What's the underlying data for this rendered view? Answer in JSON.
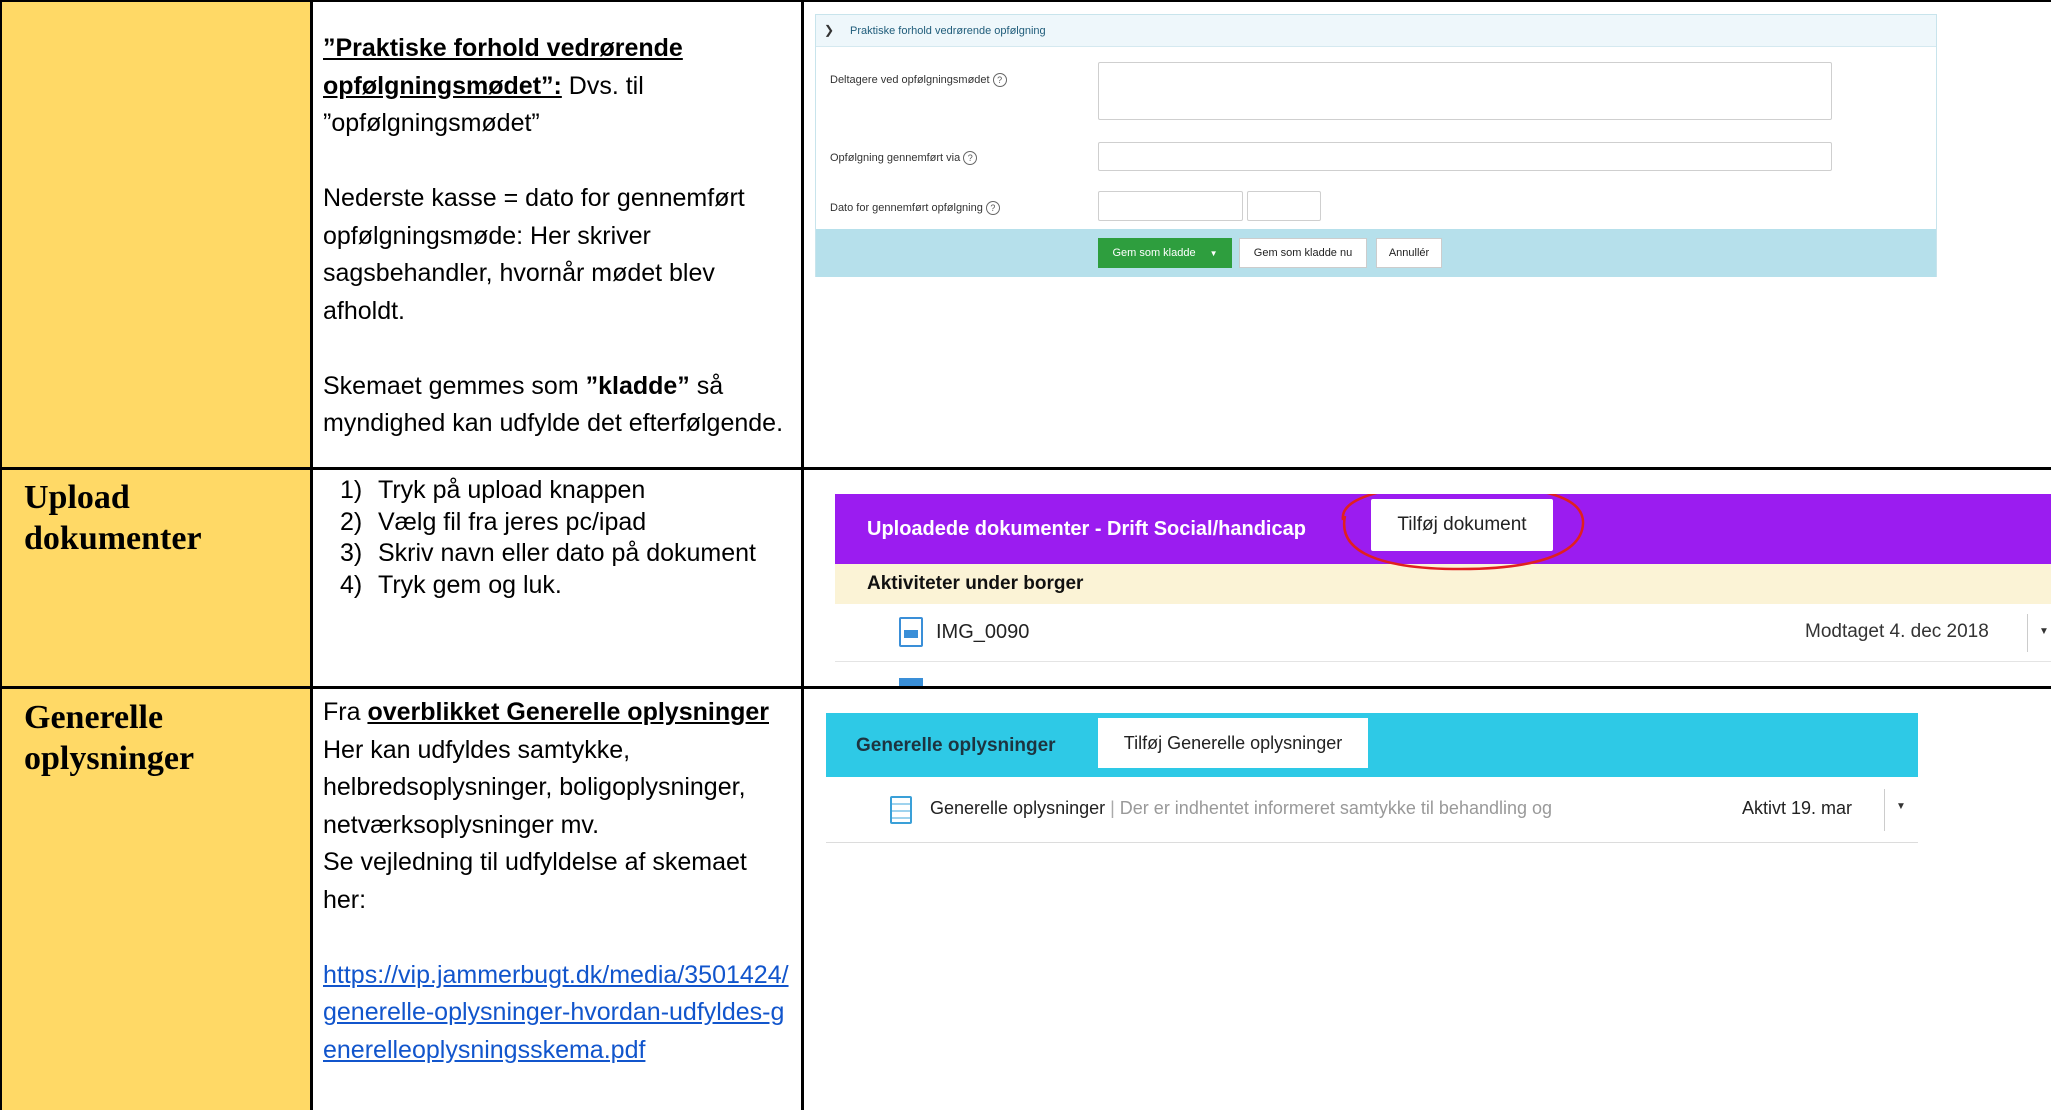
{
  "row1": {
    "desc_title": "”Praktiske forhold vedrørende opfølgningsmødet”:",
    "desc_title_suffix": " Dvs. til ”opfølgningsmødet”",
    "desc_p2": "Nederste kasse = dato for gennemført opfølgningsmøde: Her skriver sagsbehandler, hvornår mødet blev afholdt.",
    "desc_p3_a": "Skemaet gemmes som ",
    "desc_p3_b": "”kladde”",
    "desc_p3_c": " så myndighed kan udfylde det efterfølgende.",
    "screenshot": {
      "section_title": "Praktiske forhold vedrørende opfølgning",
      "field1_label": "Deltagere ved opfølgningsmødet",
      "field2_label": "Opfølgning gennemført via",
      "field3_label": "Dato for gennemført opfølgning",
      "help_glyph": "?",
      "btn_save_draft": "Gem som kladde",
      "btn_save_draft_now": "Gem som kladde nu",
      "btn_cancel": "Annullér"
    }
  },
  "row2": {
    "heading_line1": "Upload",
    "heading_line2": "dokumenter",
    "steps": [
      {
        "num": "1)",
        "text": "Tryk på upload knappen"
      },
      {
        "num": "2)",
        "text": "Vælg fil fra jeres pc/ipad"
      },
      {
        "num": "3)",
        "text": "Skriv navn eller dato på dokument"
      },
      {
        "num": "4)",
        "text": "Tryk gem og luk."
      }
    ],
    "screenshot": {
      "header_title": "Uploadede dokumenter - Drift Social/handicap",
      "add_button": "Tilføj dokument",
      "subheader": "Aktiviteter under borger",
      "doc_name": "IMG_0090",
      "doc_status": "Modtaget 4. dec 2018",
      "header_color": "#9b1cf0",
      "highlight_color": "#e02020"
    }
  },
  "row3": {
    "heading_line1": "Generelle",
    "heading_line2": "oplysninger",
    "intro_a": "Fra ",
    "intro_b": "overblikket Generelle oplysninger",
    "line2": "Her kan udfyldes samtykke, helbredsoplysninger, boligoplysninger, netværksoplysninger mv.",
    "line3": "Se vejledning til udfyldelse af skemaet her:",
    "link": "https://vip.jammerbugt.dk/media/3501424/generelle-oplysninger-hvordan-udfyldes-generelleoplysningsskema.pdf",
    "screenshot": {
      "header_title": "Generelle oplysninger",
      "add_button": "Tilføj Generelle oplysninger",
      "item_name": "Generelle oplysninger",
      "item_desc": "Der er indhentet informeret samtykke til behandling og",
      "item_status": "Aktivt 19. mar",
      "header_color": "#2ec9e6"
    }
  }
}
